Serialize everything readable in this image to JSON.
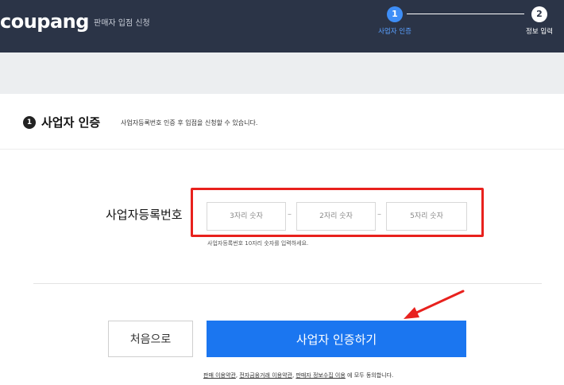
{
  "header": {
    "logo": "coupang",
    "subtitle": "판매자 입점 신청",
    "steps": [
      {
        "num": "1",
        "label": "사업자 인증"
      },
      {
        "num": "2",
        "label": "정보 입력"
      }
    ]
  },
  "section": {
    "num": "1",
    "title": "사업자 인증",
    "description": "사업자등록번호 인증 후 입점을 신청할 수 있습니다."
  },
  "form": {
    "label": "사업자등록번호",
    "inputs": [
      {
        "placeholder": "3자리 숫자"
      },
      {
        "placeholder": "2자리 숫자"
      },
      {
        "placeholder": "5자리 숫자"
      }
    ],
    "separator": "–",
    "hint": "사업자등록번호 10자리 숫자를 입력하세요."
  },
  "buttons": {
    "back": "처음으로",
    "verify": "사업자 인증하기"
  },
  "terms": {
    "link1": "판매 이용약관",
    "sep1": ", ",
    "link2": "전자금융거래 이용약관",
    "sep2": ", ",
    "link3": "판매자 정보수집 이용",
    "suffix": " 에 모두 동의합니다."
  },
  "colors": {
    "header_bg": "#2b3447",
    "accent": "#1b76f0",
    "annotation": "#e8211d"
  },
  "icons": {
    "annotation_arrow": "red-arrow-icon"
  }
}
